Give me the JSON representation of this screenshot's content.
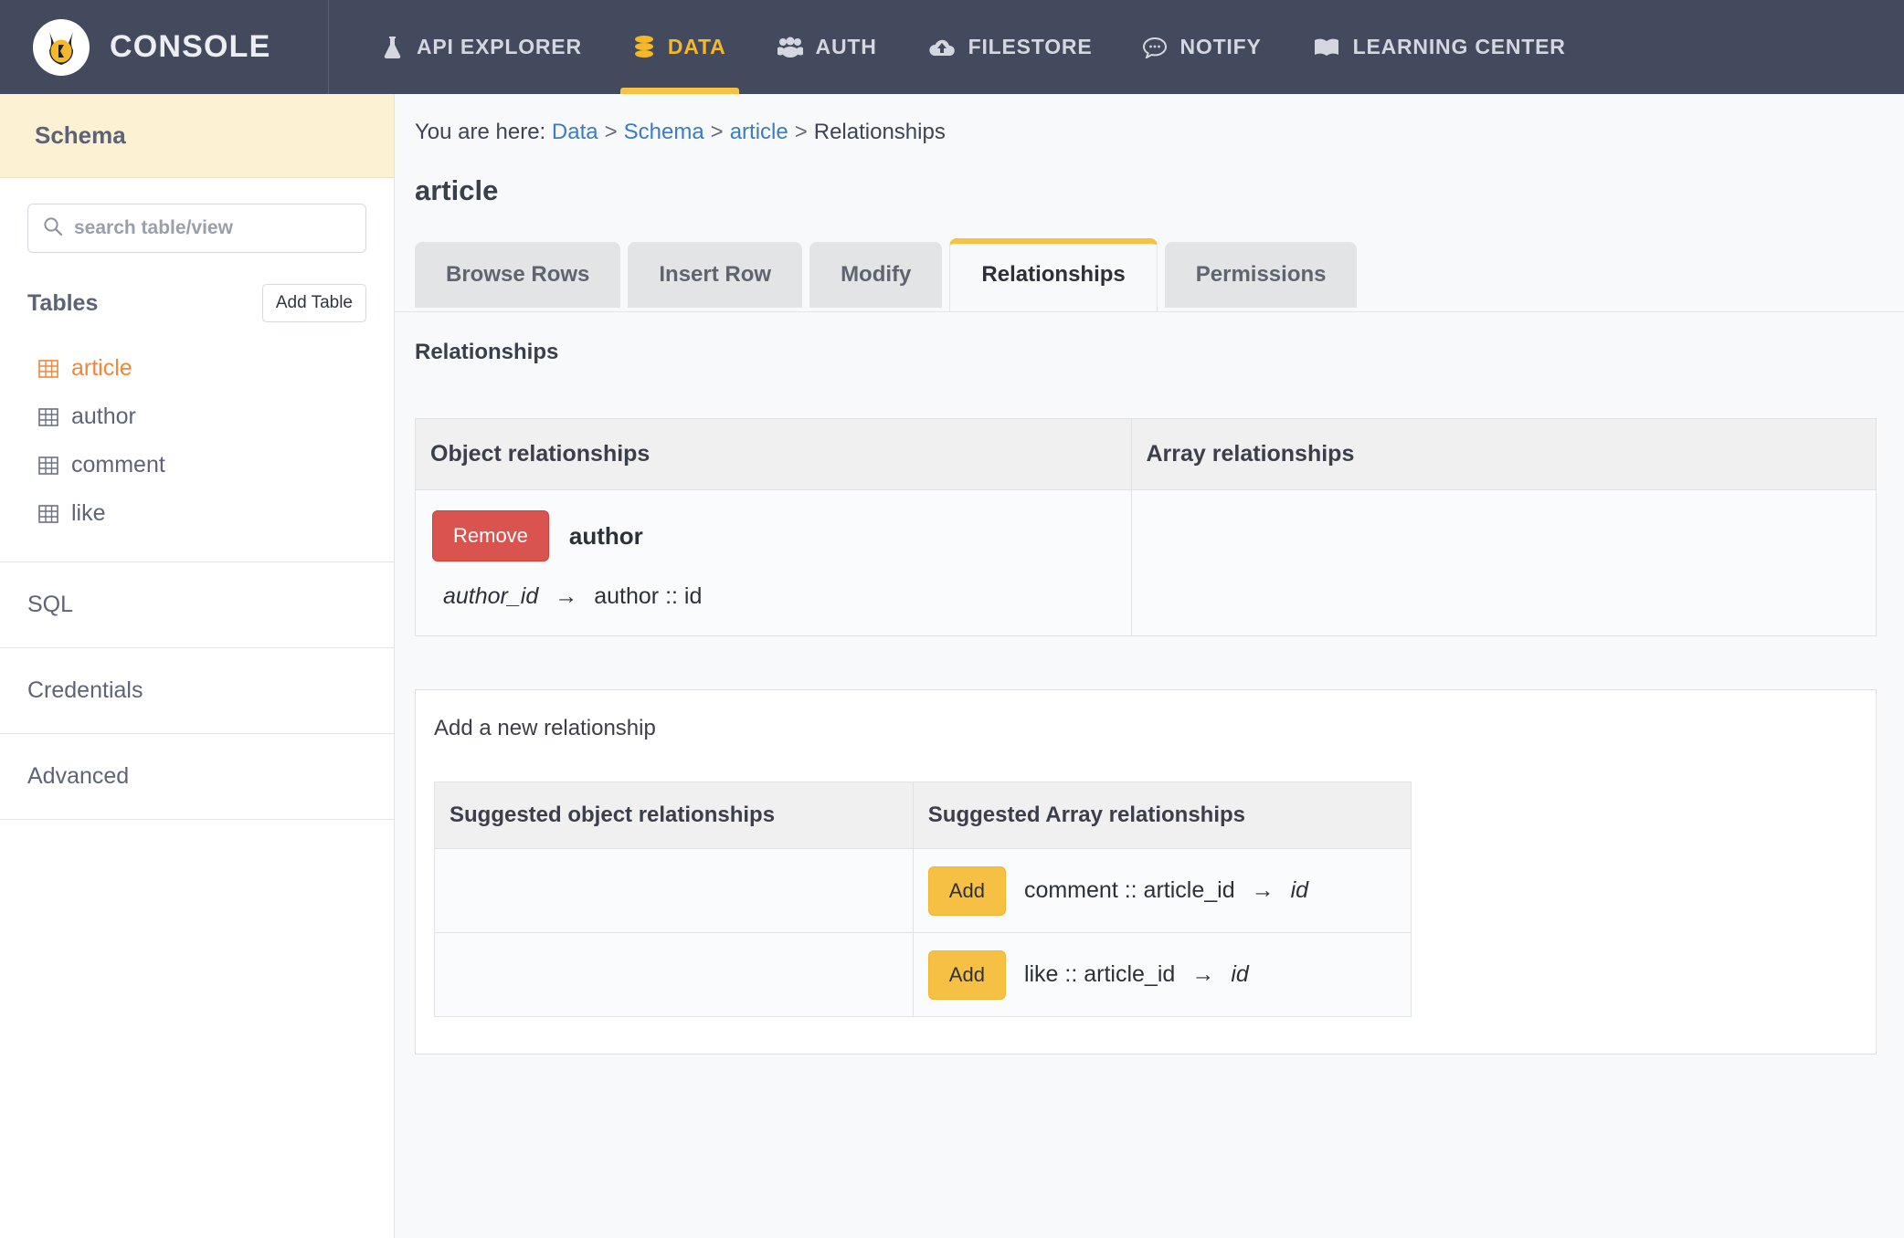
{
  "topnav": {
    "brand": "CONSOLE",
    "logo_icon": "hasura-mascot-icon",
    "items": [
      {
        "label": "API EXPLORER",
        "icon": "flask-icon",
        "active": false
      },
      {
        "label": "DATA",
        "icon": "database-icon",
        "active": true
      },
      {
        "label": "AUTH",
        "icon": "users-icon",
        "active": false
      },
      {
        "label": "FILESTORE",
        "icon": "cloud-upload-icon",
        "active": false
      },
      {
        "label": "NOTIFY",
        "icon": "chat-bubble-icon",
        "active": false
      },
      {
        "label": "LEARNING CENTER",
        "icon": "book-icon",
        "active": false
      }
    ],
    "bg_color": "#444a5e",
    "active_color": "#f5b829"
  },
  "sidebar": {
    "schema_title": "Schema",
    "search": {
      "placeholder": "search table/view",
      "value": "",
      "icon": "search-icon"
    },
    "tables_label": "Tables",
    "add_table_label": "Add Table",
    "tables": [
      {
        "name": "article",
        "icon": "table-grid-icon",
        "active": true
      },
      {
        "name": "author",
        "icon": "table-grid-icon",
        "active": false
      },
      {
        "name": "comment",
        "icon": "table-grid-icon",
        "active": false
      },
      {
        "name": "like",
        "icon": "table-grid-icon",
        "active": false
      }
    ],
    "links": [
      {
        "label": "SQL"
      },
      {
        "label": "Credentials"
      },
      {
        "label": "Advanced"
      }
    ],
    "active_table_color": "#f0873a"
  },
  "main": {
    "breadcrumb": {
      "prefix": "You are here:",
      "items": [
        {
          "label": "Data",
          "link": true
        },
        {
          "label": "Schema",
          "link": true
        },
        {
          "label": "article",
          "link": true
        },
        {
          "label": "Relationships",
          "link": false
        }
      ],
      "separator": ">"
    },
    "page_title": "article",
    "tabs": [
      {
        "label": "Browse Rows",
        "active": false
      },
      {
        "label": "Insert Row",
        "active": false
      },
      {
        "label": "Modify",
        "active": false
      },
      {
        "label": "Relationships",
        "active": true
      },
      {
        "label": "Permissions",
        "active": false
      }
    ],
    "section_label": "Relationships",
    "relationships_table": {
      "headers": [
        "Object relationships",
        "Array relationships"
      ],
      "object_relationships": [
        {
          "remove_label": "Remove",
          "name": "author",
          "source_column": "author_id",
          "arrow": "→",
          "target": "author :: id"
        }
      ],
      "array_relationships": []
    },
    "add_panel": {
      "title": "Add a new relationship",
      "headers": [
        "Suggested object relationships",
        "Suggested Array relationships"
      ],
      "suggested_object": [],
      "suggested_array": [
        {
          "add_label": "Add",
          "source": "comment :: article_id",
          "arrow": "→",
          "target": "id"
        },
        {
          "add_label": "Add",
          "source": "like :: article_id",
          "arrow": "→",
          "target": "id"
        }
      ]
    }
  },
  "colors": {
    "remove_button": "#d9534f",
    "add_button": "#f6c045",
    "link": "#3b7bc8",
    "accent_yellow": "#f5c244"
  }
}
